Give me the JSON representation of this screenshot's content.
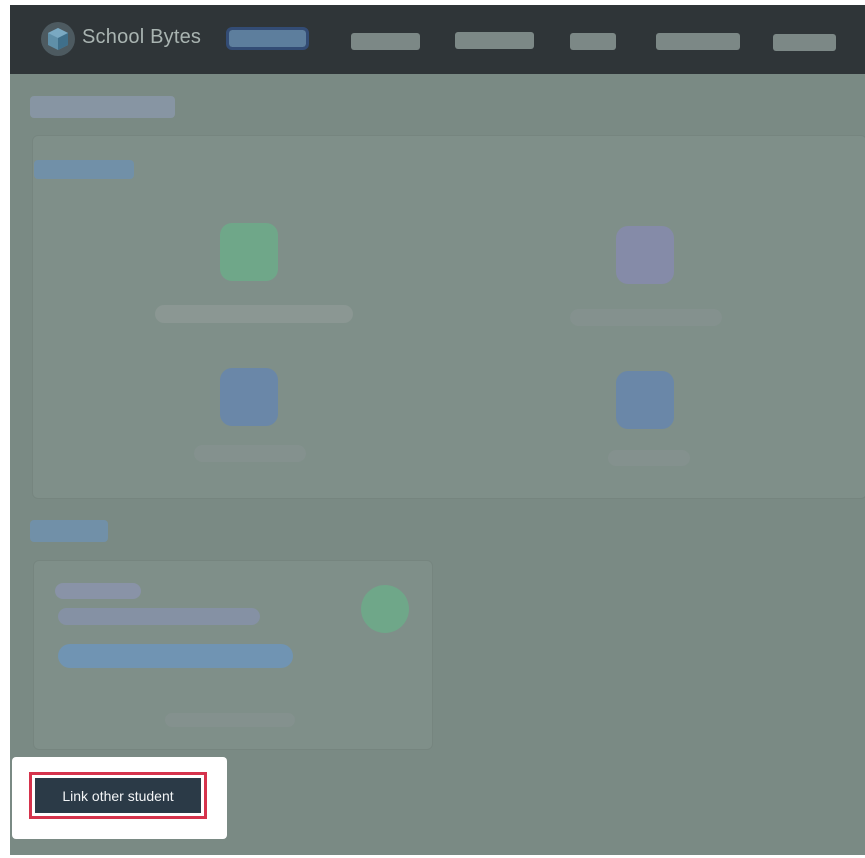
{
  "header": {
    "brand": "School Bytes",
    "logo_icon": "cube-logo-icon"
  },
  "action": {
    "link_student_label": "Link other student"
  },
  "colors": {
    "topbar": "#2f3538",
    "overlay": "#7a8a84",
    "button_bg": "#2b3a47",
    "highlight_border": "#d5334c"
  }
}
